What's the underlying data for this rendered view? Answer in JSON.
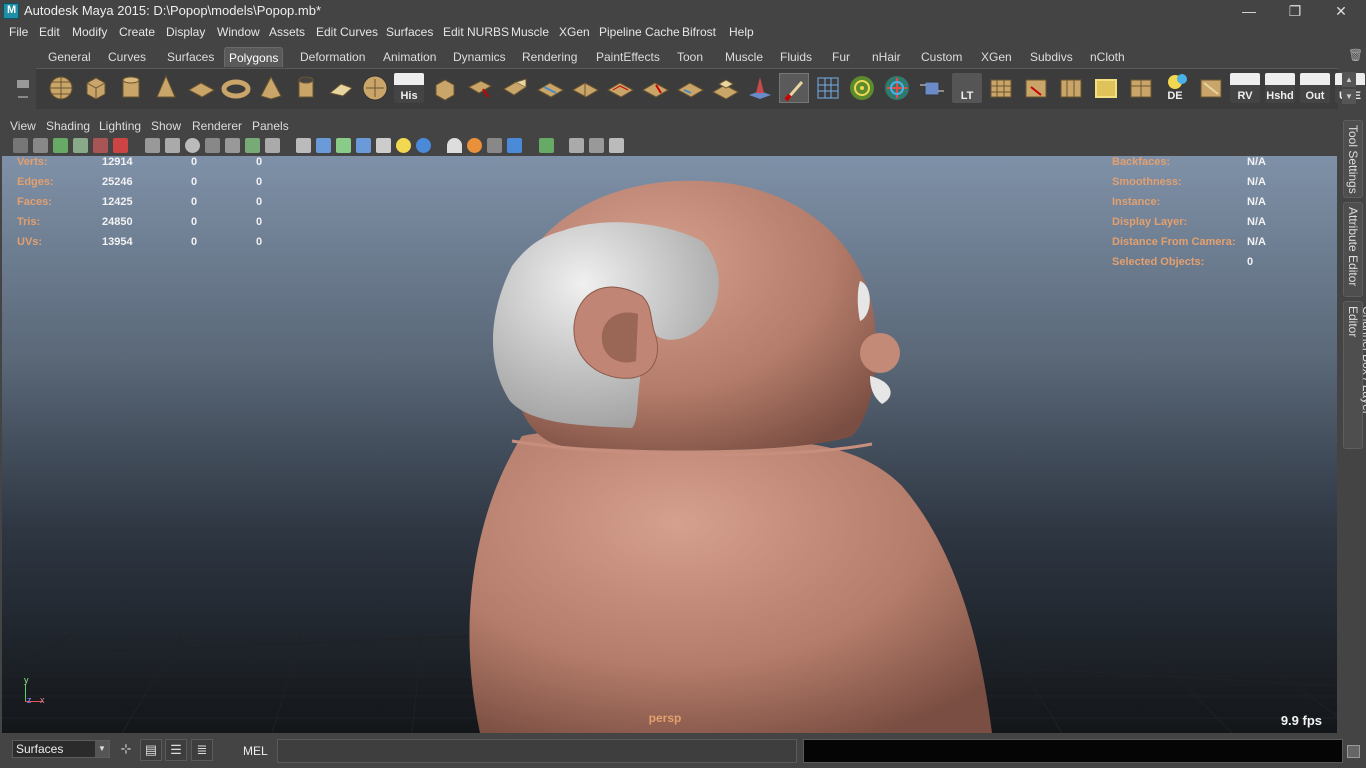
{
  "window": {
    "title": "Autodesk Maya 2015: D:\\Popop\\models\\Popop.mb*",
    "minimize": "—",
    "restore": "❐",
    "close": "✕"
  },
  "menubar": [
    "File",
    "Edit",
    "Modify",
    "Create",
    "Display",
    "Window",
    "Assets",
    "Edit Curves",
    "Surfaces",
    "Edit NURBS",
    "Muscle",
    "XGen",
    "Pipeline Cache",
    "Bifrost",
    "Help"
  ],
  "shelf_tabs": {
    "items": [
      "General",
      "Curves",
      "Surfaces",
      "Polygons",
      "Deformation",
      "Animation",
      "Dynamics",
      "Rendering",
      "PaintEffects",
      "Toon",
      "Muscle",
      "Fluids",
      "Fur",
      "nHair",
      "Custom",
      "XGen",
      "Subdivs",
      "nCloth"
    ],
    "active": "Polygons"
  },
  "shelf_buttons": {
    "his": "His",
    "lt": "LT",
    "de": "DE",
    "rv": "RV",
    "hshd": "Hshd",
    "out": "Out",
    "ute": "UTE"
  },
  "panel_menu": [
    "View",
    "Shading",
    "Lighting",
    "Show",
    "Renderer",
    "Panels"
  ],
  "hud": {
    "left_rows": [
      {
        "label": "Verts:",
        "v1": "12914",
        "v2": "0",
        "v3": "0"
      },
      {
        "label": "Edges:",
        "v1": "25246",
        "v2": "0",
        "v3": "0"
      },
      {
        "label": "Faces:",
        "v1": "12425",
        "v2": "0",
        "v3": "0"
      },
      {
        "label": "Tris:",
        "v1": "24850",
        "v2": "0",
        "v3": "0"
      },
      {
        "label": "UVs:",
        "v1": "13954",
        "v2": "0",
        "v3": "0"
      }
    ],
    "right_rows": [
      {
        "label": "Backfaces:",
        "value": "N/A"
      },
      {
        "label": "Smoothness:",
        "value": "N/A"
      },
      {
        "label": "Instance:",
        "value": "N/A"
      },
      {
        "label": "Display Layer:",
        "value": "N/A"
      },
      {
        "label": "Distance From Camera:",
        "value": "N/A"
      },
      {
        "label": "Selected Objects:",
        "value": "0"
      }
    ],
    "camera": "persp",
    "fps": "9.9 fps",
    "axis_y": "y",
    "axis_x": "x",
    "axis_z": "z"
  },
  "side_tabs": [
    "Tool Settings",
    "Attribute Editor",
    "Channel Box / Layer Editor"
  ],
  "bottom": {
    "mode": "Surfaces",
    "mel_label": "MEL"
  },
  "colors": {
    "ui_bg": "#444444",
    "hud_label": "#e3a06e",
    "skin": "#b98070",
    "hair": "#d8d8d8"
  }
}
